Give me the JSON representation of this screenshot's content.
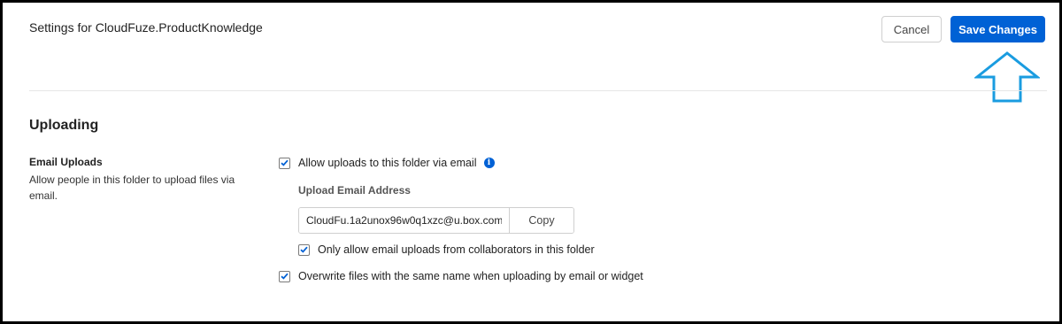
{
  "header": {
    "title": "Settings for CloudFuze.ProductKnowledge",
    "cancel_label": "Cancel",
    "save_label": "Save Changes"
  },
  "section": {
    "title": "Uploading"
  },
  "email_uploads": {
    "label": "Email Uploads",
    "description": "Allow people in this folder to upload files via email.",
    "allow_uploads_label": "Allow uploads to this folder via email",
    "info_icon": "i",
    "address_label": "Upload Email Address",
    "address_value": "CloudFu.1a2unox96w0q1xzc@u.box.com",
    "copy_label": "Copy",
    "collaborators_only_label": "Only allow email uploads from collaborators in this folder",
    "overwrite_label": "Overwrite files with the same name when uploading by email or widget"
  },
  "state": {
    "allow_uploads_checked": true,
    "collaborators_only_checked": true,
    "overwrite_checked": true
  },
  "colors": {
    "accent": "#0061d5",
    "callout_arrow": "#1a9ce0"
  },
  "icons": {
    "callout": "up-arrow-icon",
    "check": "checkmark-icon",
    "info": "info-icon"
  }
}
